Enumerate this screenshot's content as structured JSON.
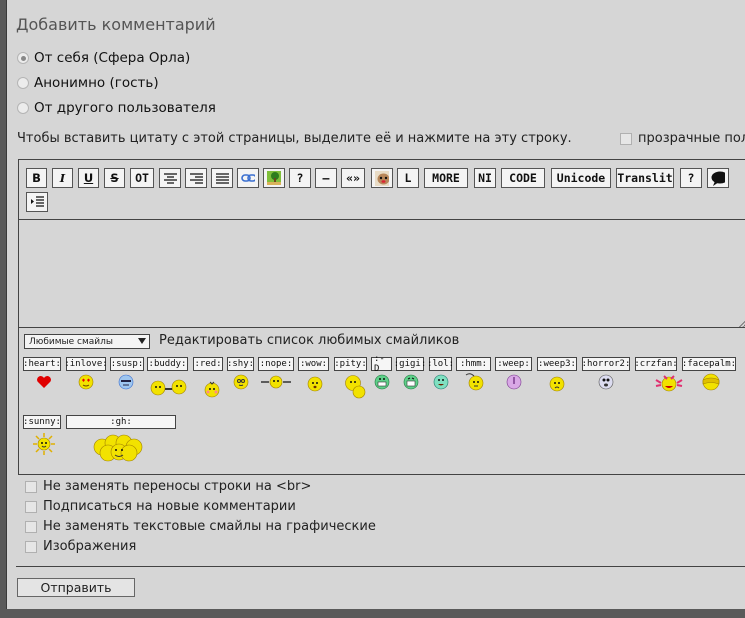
{
  "title": "Добавить комментарий",
  "identity_options": [
    {
      "label": "От себя (Сфера Орла)",
      "selected": true
    },
    {
      "label": "Анонимно (гость)",
      "selected": false
    },
    {
      "label": "От другого пользователя",
      "selected": false
    }
  ],
  "quote_hint": "Чтобы вставить цитату с этой страницы, выделите её и нажмите на эту строку.",
  "transparent_fields": "прозрачные поля",
  "toolbar": {
    "bold": "B",
    "italic": "I",
    "underline": "U",
    "strike": "S",
    "ot": "OT",
    "center": "≡",
    "right": "≡",
    "justify": "≡",
    "question": "?",
    "dash": "—",
    "quotes": "«»",
    "l": "L",
    "more": "MORE",
    "ni": "NI",
    "code": "CODE",
    "unicode": "Unicode",
    "translit": "Translit",
    "help": "?"
  },
  "smileys": {
    "favorites_select": "Любимые смайлы",
    "edit_favorites": "Редактировать список любимых смайликов",
    "tags": [
      ":heart:",
      ":inlove:",
      ":susp:",
      ":buddy:",
      ":red:",
      ":shy:",
      ":nope:",
      ":wow:",
      ":pity:",
      ":-D",
      ":gigi:",
      ":lol:",
      ":hmm:",
      ":weep:",
      ":weep3:",
      ":horror2:",
      ":crzfan:",
      ":facepalm:",
      ":sunny:",
      ":gh:"
    ]
  },
  "options": [
    "Не заменять переносы строки на <br>",
    "Подписаться на новые комментарии",
    "Не заменять текстовые смайлы на графические",
    "Изображения"
  ],
  "submit": "Отправить",
  "colors": {
    "panel": "#d6d6d6",
    "outer": "#5a5a5a",
    "smiley_yellow": "#f2e200",
    "heart_red": "#e00000"
  }
}
